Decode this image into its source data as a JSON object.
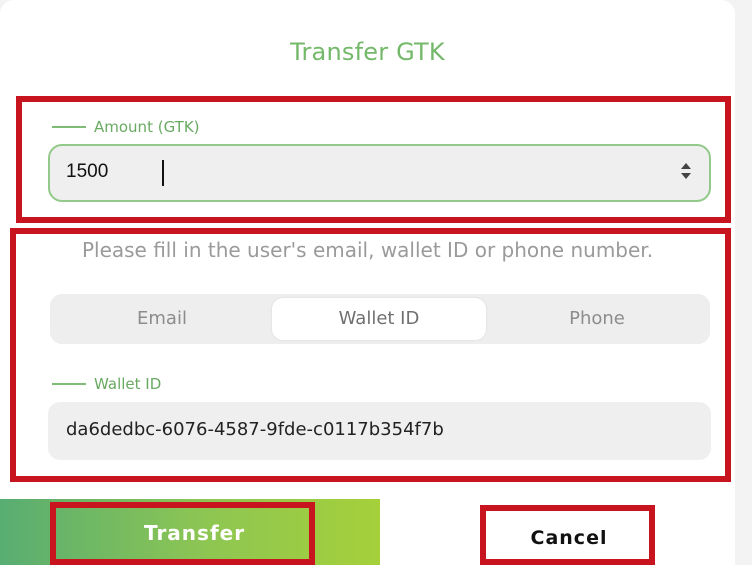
{
  "dialog": {
    "title": "Transfer GTK"
  },
  "amount": {
    "label": "Amount (GTK)",
    "value": "1500"
  },
  "recipient": {
    "instruction": "Please fill in the user's email, wallet ID or phone number.",
    "tabs": [
      {
        "label": "Email",
        "active": false
      },
      {
        "label": "Wallet ID",
        "active": true
      },
      {
        "label": "Phone",
        "active": false
      }
    ],
    "field_label": "Wallet ID",
    "field_value": "da6dedbc-6076-4587-9fde-c0117b354f7b"
  },
  "actions": {
    "transfer_label": "Transfer",
    "cancel_label": "Cancel"
  },
  "colors": {
    "accent_green": "#74b86a",
    "highlight_red": "#c7141f",
    "button_gradient_start": "#58ad72",
    "button_gradient_end": "#a5d03a"
  }
}
